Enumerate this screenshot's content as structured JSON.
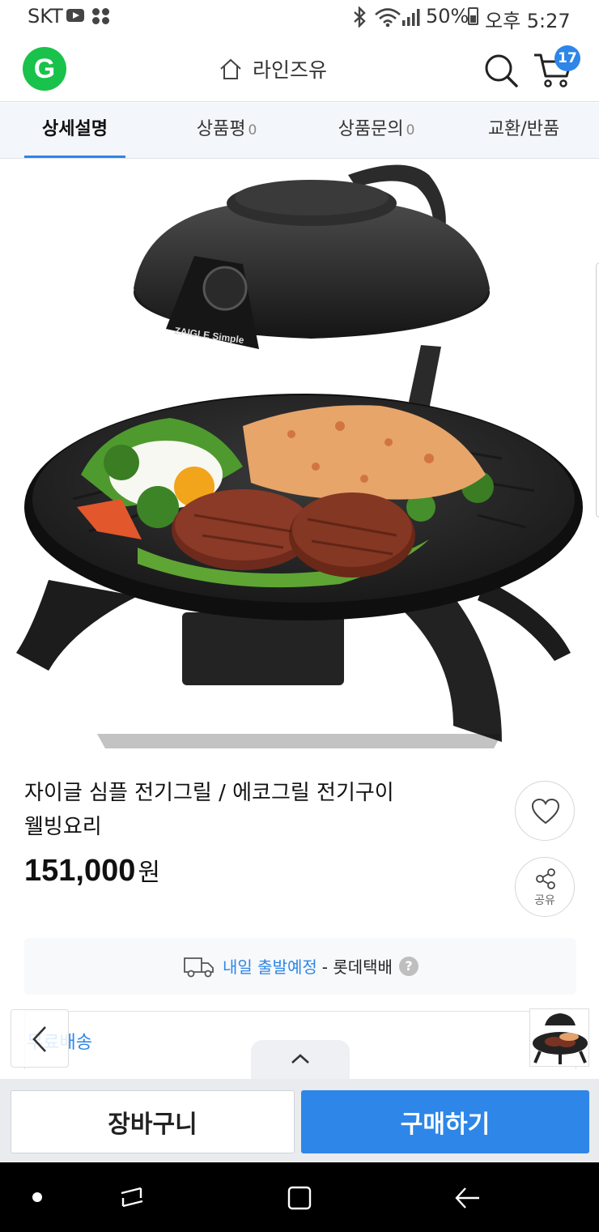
{
  "status_bar": {
    "carrier": "SKT",
    "battery": "50%",
    "time": "오후 5:27"
  },
  "header": {
    "logo_text": "G",
    "store_name": "라인즈유",
    "cart_count": "17"
  },
  "tabs": [
    {
      "label": "상세설명",
      "count": ""
    },
    {
      "label": "상품평",
      "count": "0"
    },
    {
      "label": "상품문의",
      "count": "0"
    },
    {
      "label": "교환/반품",
      "count": ""
    }
  ],
  "product": {
    "title_line1": "자이글 심플 전기그릴 / 에코그릴 전기구이",
    "title_line2": "웰빙요리",
    "price": "151,000",
    "currency": "원",
    "brand_on_product": "ZAIGLE Simple",
    "share_label": "공유"
  },
  "shipping": {
    "highlight": "내일 출발예정",
    "courier": "- 롯데택배",
    "help": "?",
    "free_shipping": "무료배송"
  },
  "actions": {
    "cart": "장바구니",
    "buy": "구매하기"
  },
  "colors": {
    "accent": "#2d86e8",
    "logo": "#19c24a"
  }
}
